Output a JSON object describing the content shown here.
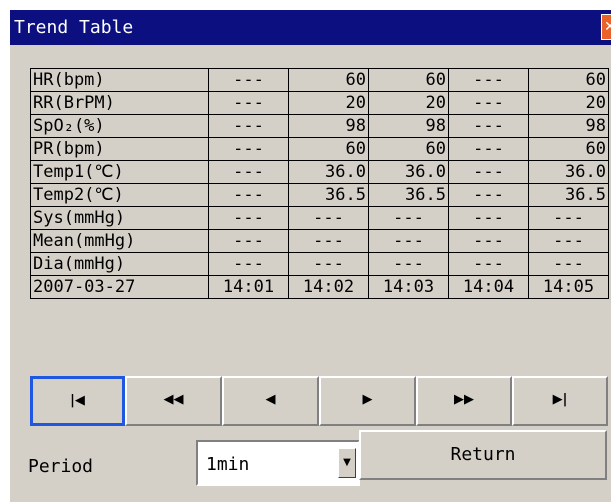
{
  "window": {
    "title": "Trend Table",
    "close_glyph": "✕"
  },
  "table": {
    "rows": [
      {
        "label": "HR(bpm)",
        "values": [
          "---",
          "60",
          "60",
          "---",
          "60"
        ]
      },
      {
        "label": "RR(BrPM)",
        "values": [
          "---",
          "20",
          "20",
          "---",
          "20"
        ]
      },
      {
        "label": "SpO₂(%)",
        "values": [
          "---",
          "98",
          "98",
          "---",
          "98"
        ]
      },
      {
        "label": "PR(bpm)",
        "values": [
          "---",
          "60",
          "60",
          "---",
          "60"
        ]
      },
      {
        "label": "Temp1(℃)",
        "values": [
          "---",
          "36.0",
          "36.0",
          "---",
          "36.0"
        ]
      },
      {
        "label": "Temp2(℃)",
        "values": [
          "---",
          "36.5",
          "36.5",
          "---",
          "36.5"
        ]
      },
      {
        "label": "Sys(mmHg)",
        "values": [
          "---",
          "---",
          "---",
          "---",
          "---"
        ]
      },
      {
        "label": "Mean(mmHg)",
        "values": [
          "---",
          "---",
          "---",
          "---",
          "---"
        ]
      },
      {
        "label": "Dia(mmHg)",
        "values": [
          "---",
          "---",
          "---",
          "---",
          "---"
        ]
      }
    ],
    "date_label": "2007-03-27",
    "times": [
      "14:01",
      "14:02",
      "14:03",
      "14:04",
      "14:05"
    ]
  },
  "nav": {
    "first": "⏮",
    "prev_page": "⏪",
    "prev": "◀",
    "next": "▶",
    "next_page": "⏩",
    "last": "⏭"
  },
  "nav_glyphs": {
    "first": "|◀",
    "prev_page": "◀◀",
    "prev": "◀",
    "next": "▶",
    "next_page": "▶▶",
    "last": "▶|"
  },
  "period": {
    "label": "Period",
    "value": "1min",
    "arrow": "▼"
  },
  "return_label": "Return",
  "colors": {
    "title_bar": "#0b0f80",
    "panel": "#d4d0c8",
    "selected_border": "#1f57e0",
    "close": "#e8622a"
  }
}
